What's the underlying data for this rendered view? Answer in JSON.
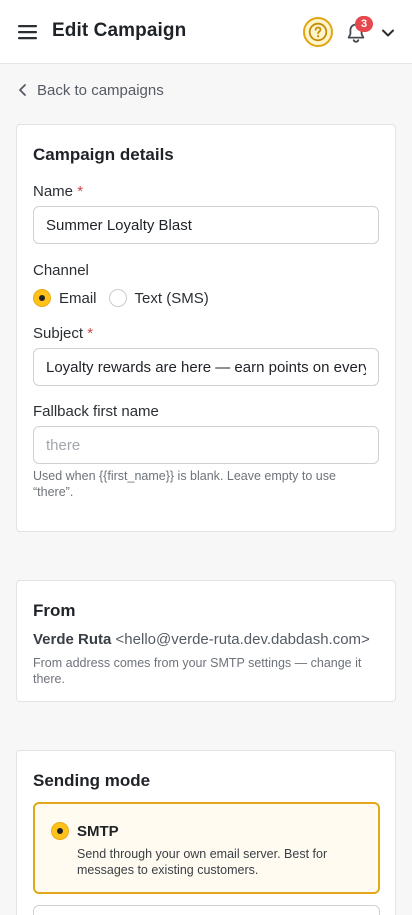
{
  "header": {
    "title": "Edit Campaign",
    "notification_count": "3",
    "icons": {
      "menu": "hamburger-icon",
      "help": "question-circle-icon",
      "bell": "bell-icon",
      "user_menu": "chevron-down-icon"
    },
    "colors": {
      "help_border": "#e0a713",
      "badge": "#e5484d"
    }
  },
  "nav": {
    "back_label": "Back to campaigns"
  },
  "details": {
    "title": "Campaign details",
    "name_label": "Name",
    "name_value": "Summer Loyalty Blast",
    "required_mark": "*",
    "channel_label": "Channel",
    "channel_options": [
      {
        "label": "Email",
        "selected": true
      },
      {
        "label": "Text (SMS)",
        "selected": false
      }
    ],
    "subject_label": "Subject",
    "subject_value": "Loyalty rewards are here — earn points on every",
    "fallback_label": "Fallback first name",
    "fallback_placeholder": "there",
    "fallback_value": "",
    "fallback_hint": "Used when {{first_name}} is blank. Leave empty to use “there”."
  },
  "from": {
    "title": "From",
    "sender_name": "Verde Ruta",
    "sender_email": "<hello@verde-ruta.dev.dabdash.com>",
    "hint": "From address comes from your SMTP settings — change it there."
  },
  "sending_mode": {
    "title": "Sending mode",
    "options": [
      {
        "label": "SMTP",
        "description": "Send through your own email server. Best for messages to existing customers.",
        "selected": true
      }
    ]
  },
  "accent_color": "#ffc21a"
}
